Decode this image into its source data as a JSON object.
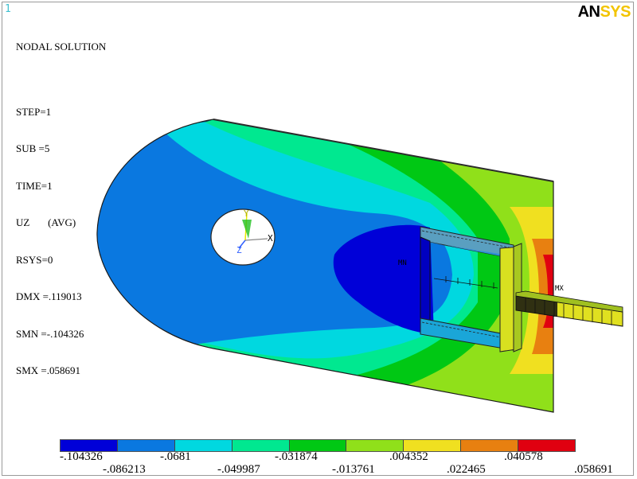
{
  "window": {
    "number": "1",
    "logo_primary": "AN",
    "logo_secondary": "SYS"
  },
  "solution_info": [
    "NODAL SOLUTION",
    "",
    "STEP=1",
    "SUB =5",
    "TIME=1",
    "UZ       (AVG)",
    "RSYS=0",
    "DMX =.119013",
    "SMN =-.104326",
    "SMX =.058691"
  ],
  "markers": {
    "min_label": "MN",
    "max_label": "MX",
    "axis_x": "X",
    "axis_y": "Y",
    "axis_z": "Z"
  },
  "legend": {
    "colors": [
      "#0000d8",
      "#0a78e0",
      "#00d8e0",
      "#00e890",
      "#00c814",
      "#90e01a",
      "#f0e020",
      "#e88010",
      "#e00010"
    ],
    "values": [
      ".104326",
      ".086213",
      ".0681",
      ".049987",
      ".031874",
      ".013761",
      ".004352",
      ".022465",
      ".040578",
      ".058691"
    ],
    "signs": [
      "-",
      "-",
      "-",
      "-",
      "-",
      "-",
      "",
      "",
      "",
      ""
    ]
  }
}
